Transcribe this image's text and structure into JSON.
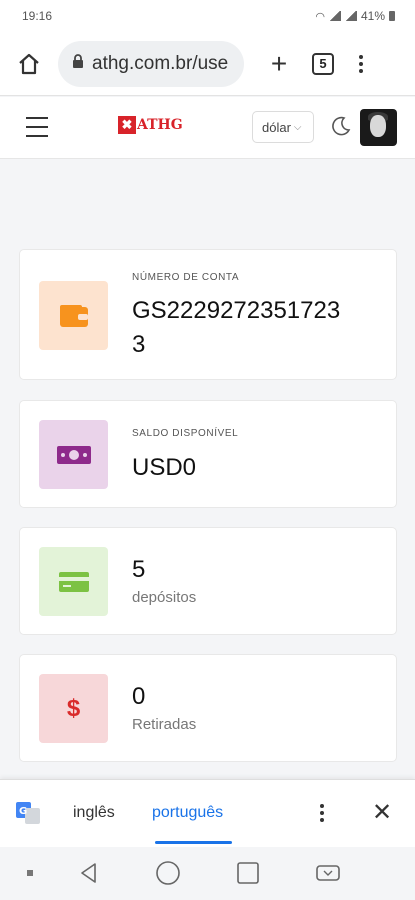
{
  "status_bar": {
    "time": "19:16",
    "battery": "41%"
  },
  "browser": {
    "url": "athg.com.br/use",
    "tab_count": "5",
    "new_tab_label": "+"
  },
  "header": {
    "logo_text": "ATHG",
    "logo_mark": "✖",
    "currency": "dólar"
  },
  "cards": [
    {
      "label": "NÚMERO DE CONTA",
      "value_line1": "GS2229272351723",
      "value_line2": "3",
      "icon": "wallet-icon",
      "bg": "#fde3cf",
      "color": "#f7931e"
    },
    {
      "label": "SALDO DISPONÍVEL",
      "value": "USD0",
      "icon": "money-icon",
      "bg": "#ead3ea",
      "color": "#8e2a8b"
    },
    {
      "value": "5",
      "sub": "depósitos",
      "icon": "credit-card-icon",
      "bg": "#e3f3d8",
      "color": "#7cc243"
    },
    {
      "value": "0",
      "sub": "Retiradas",
      "icon": "dollar-icon",
      "bg": "#f7d7d9",
      "color": "#d92b2b",
      "glyph": "$"
    }
  ],
  "translate_bar": {
    "lang_from": "inglês",
    "lang_to": "português",
    "close": "✕"
  },
  "colors": {
    "accent": "#1a73e8",
    "brand": "#d8232a"
  }
}
